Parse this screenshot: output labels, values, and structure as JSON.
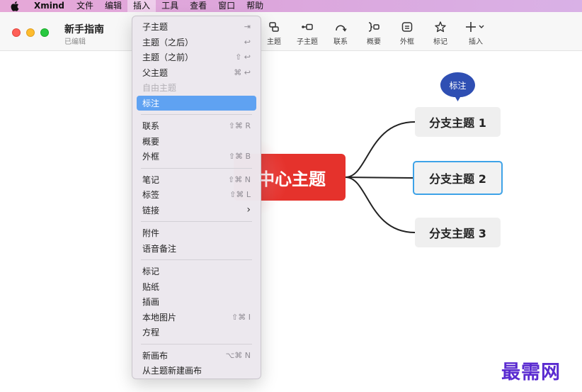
{
  "menubar": {
    "app": "Xmind",
    "items": [
      "文件",
      "编辑",
      "插入",
      "工具",
      "查看",
      "窗口",
      "帮助"
    ],
    "active": "插入"
  },
  "window": {
    "title": "新手指南",
    "status": "已编辑"
  },
  "toolbar": {
    "tools": [
      {
        "label": "主题",
        "icon": "topic-icon"
      },
      {
        "label": "子主题",
        "icon": "subtopic-icon"
      },
      {
        "label": "联系",
        "icon": "relationship-icon"
      },
      {
        "label": "概要",
        "icon": "summary-icon"
      },
      {
        "label": "外框",
        "icon": "boundary-icon"
      },
      {
        "label": "标记",
        "icon": "star-icon"
      },
      {
        "label": "插入",
        "icon": "plus-icon"
      }
    ]
  },
  "mindmap": {
    "central": "中心主题",
    "branches": [
      "分支主题 1",
      "分支主题 2",
      "分支主题 3"
    ],
    "selected_branch": 2,
    "callout": "标注"
  },
  "dropdown": {
    "groups": [
      [
        {
          "label": "子主题",
          "shortcut": "⇥"
        },
        {
          "label": "主题（之后）",
          "shortcut": "↩"
        },
        {
          "label": "主题（之前）",
          "shortcut": "⇧ ↩"
        },
        {
          "label": "父主题",
          "shortcut": "⌘ ↩"
        },
        {
          "label": "自由主题",
          "shortcut": "",
          "disabled": true
        },
        {
          "label": "标注",
          "shortcut": "",
          "highlighted": true
        }
      ],
      [
        {
          "label": "联系",
          "shortcut": "⇧⌘ R"
        },
        {
          "label": "概要",
          "shortcut": ""
        },
        {
          "label": "外框",
          "shortcut": "⇧⌘ B"
        }
      ],
      [
        {
          "label": "笔记",
          "shortcut": "⇧⌘ N"
        },
        {
          "label": "标签",
          "shortcut": "⇧⌘ L"
        },
        {
          "label": "链接",
          "shortcut": "›",
          "submenu": true
        }
      ],
      [
        {
          "label": "附件",
          "shortcut": ""
        },
        {
          "label": "语音备注",
          "shortcut": ""
        }
      ],
      [
        {
          "label": "标记",
          "shortcut": ""
        },
        {
          "label": "贴纸",
          "shortcut": ""
        },
        {
          "label": "插画",
          "shortcut": ""
        },
        {
          "label": "本地图片",
          "shortcut": "⇧⌘ I"
        },
        {
          "label": "方程",
          "shortcut": ""
        }
      ],
      [
        {
          "label": "新画布",
          "shortcut": "⌥⌘ N"
        },
        {
          "label": "从主题新建画布",
          "shortcut": ""
        }
      ]
    ]
  },
  "watermark": "最需网",
  "colors": {
    "central_topic": "#e5322c",
    "branch_bg": "#efefef",
    "selected_border": "#3ea3e8",
    "callout_bg": "#2f4fb3",
    "menu_highlight": "#5fa2f2",
    "menubar": "#dca6dc"
  }
}
